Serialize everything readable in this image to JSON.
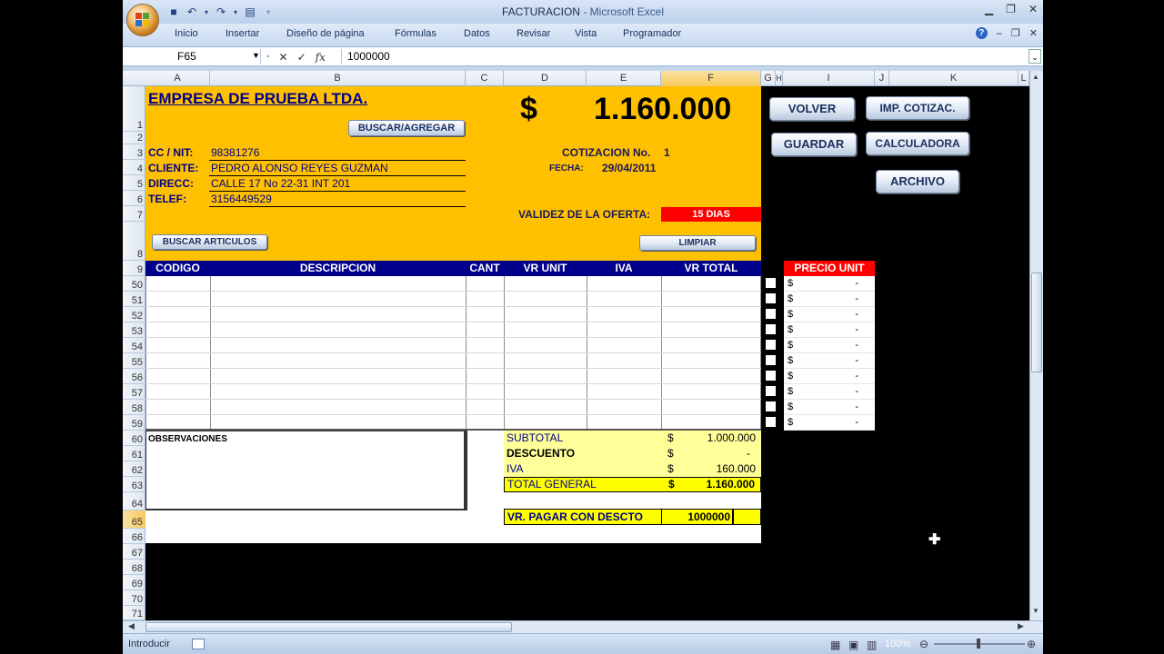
{
  "window": {
    "title_doc": "FACTURACION",
    "title_sep": " - ",
    "title_app": "Microsoft Excel"
  },
  "ribbon_tabs": [
    "Inicio",
    "Insertar",
    "Diseño de página",
    "Fórmulas",
    "Datos",
    "Revisar",
    "Vista",
    "Programador"
  ],
  "formula_bar": {
    "name_box": "F65",
    "value": "1000000"
  },
  "columns": [
    "A",
    "B",
    "C",
    "D",
    "E",
    "F",
    "G",
    "H",
    "I",
    "J",
    "K",
    "L"
  ],
  "rows_top": [
    "1",
    "2",
    "3",
    "4",
    "5",
    "6",
    "7",
    "8",
    "9"
  ],
  "rows_items": [
    "50",
    "51",
    "52",
    "53",
    "54",
    "55",
    "56",
    "57",
    "58",
    "59"
  ],
  "rows_bottom": [
    "60",
    "61",
    "62",
    "63",
    "64",
    "65",
    "66",
    "67",
    "68",
    "69",
    "70",
    "71"
  ],
  "company": "EMPRESA DE PRUEBA LTDA.",
  "total_display": {
    "currency": "$",
    "amount": "1.160.000"
  },
  "buttons": {
    "buscar_agregar": "BUSCAR/AGREGAR",
    "buscar_articulos": "BUSCAR ARTICULOS",
    "limpiar": "LIMPIAR",
    "volver": "VOLVER",
    "imp_cotizac": "IMP. COTIZAC.",
    "guardar": "GUARDAR",
    "calculadora": "CALCULADORA",
    "archivo": "ARCHIVO"
  },
  "customer": {
    "nit_label": "CC / NIT:",
    "nit": "98381276",
    "cliente_label": "CLIENTE:",
    "cliente": "PEDRO ALONSO REYES GUZMAN",
    "direcc_label": "DIRECC:",
    "direcc": "CALLE 17 No 22-31 INT 201",
    "telef_label": "TELEF:",
    "telef": "3156449529"
  },
  "quote": {
    "cotizacion_label": "COTIZACION No.",
    "cotizacion_no": "1",
    "fecha_label": "FECHA:",
    "fecha": "29/04/2011",
    "validez_label": "VALIDEZ DE LA OFERTA:",
    "validez": "15 DIAS"
  },
  "table_headers": [
    "CODIGO",
    "DESCRIPCION",
    "CANT",
    "VR UNIT",
    "IVA",
    "VR TOTAL"
  ],
  "precio_unit": {
    "header": "PRECIO UNIT",
    "rows": [
      {
        "cur": "$",
        "val": "-"
      },
      {
        "cur": "$",
        "val": "-"
      },
      {
        "cur": "$",
        "val": "-"
      },
      {
        "cur": "$",
        "val": "-"
      },
      {
        "cur": "$",
        "val": "-"
      },
      {
        "cur": "$",
        "val": "-"
      },
      {
        "cur": "$",
        "val": "-"
      },
      {
        "cur": "$",
        "val": "-"
      },
      {
        "cur": "$",
        "val": "-"
      },
      {
        "cur": "$",
        "val": "-"
      }
    ]
  },
  "observaciones": "OBSERVACIONES",
  "totals": {
    "subtotal_label": "SUBTOTAL",
    "subtotal_cur": "$",
    "subtotal": "1.000.000",
    "descuento_label": "DESCUENTO",
    "descuento_cur": "$",
    "descuento": "-",
    "iva_label": "IVA",
    "iva_cur": "$",
    "iva": "160.000",
    "total_label": "TOTAL GENERAL",
    "total_cur": "$",
    "total": "1.160.000"
  },
  "pagar": {
    "label": "VR. PAGAR CON DESCTO",
    "value": "1000000"
  },
  "status": {
    "mode": "Introducir",
    "zoom": "100%"
  },
  "colors": {
    "sheet_orange": "#ffc000",
    "header_navy": "#00008b",
    "accent_red": "#ff0000",
    "totals_yellow": "#ffff99"
  }
}
